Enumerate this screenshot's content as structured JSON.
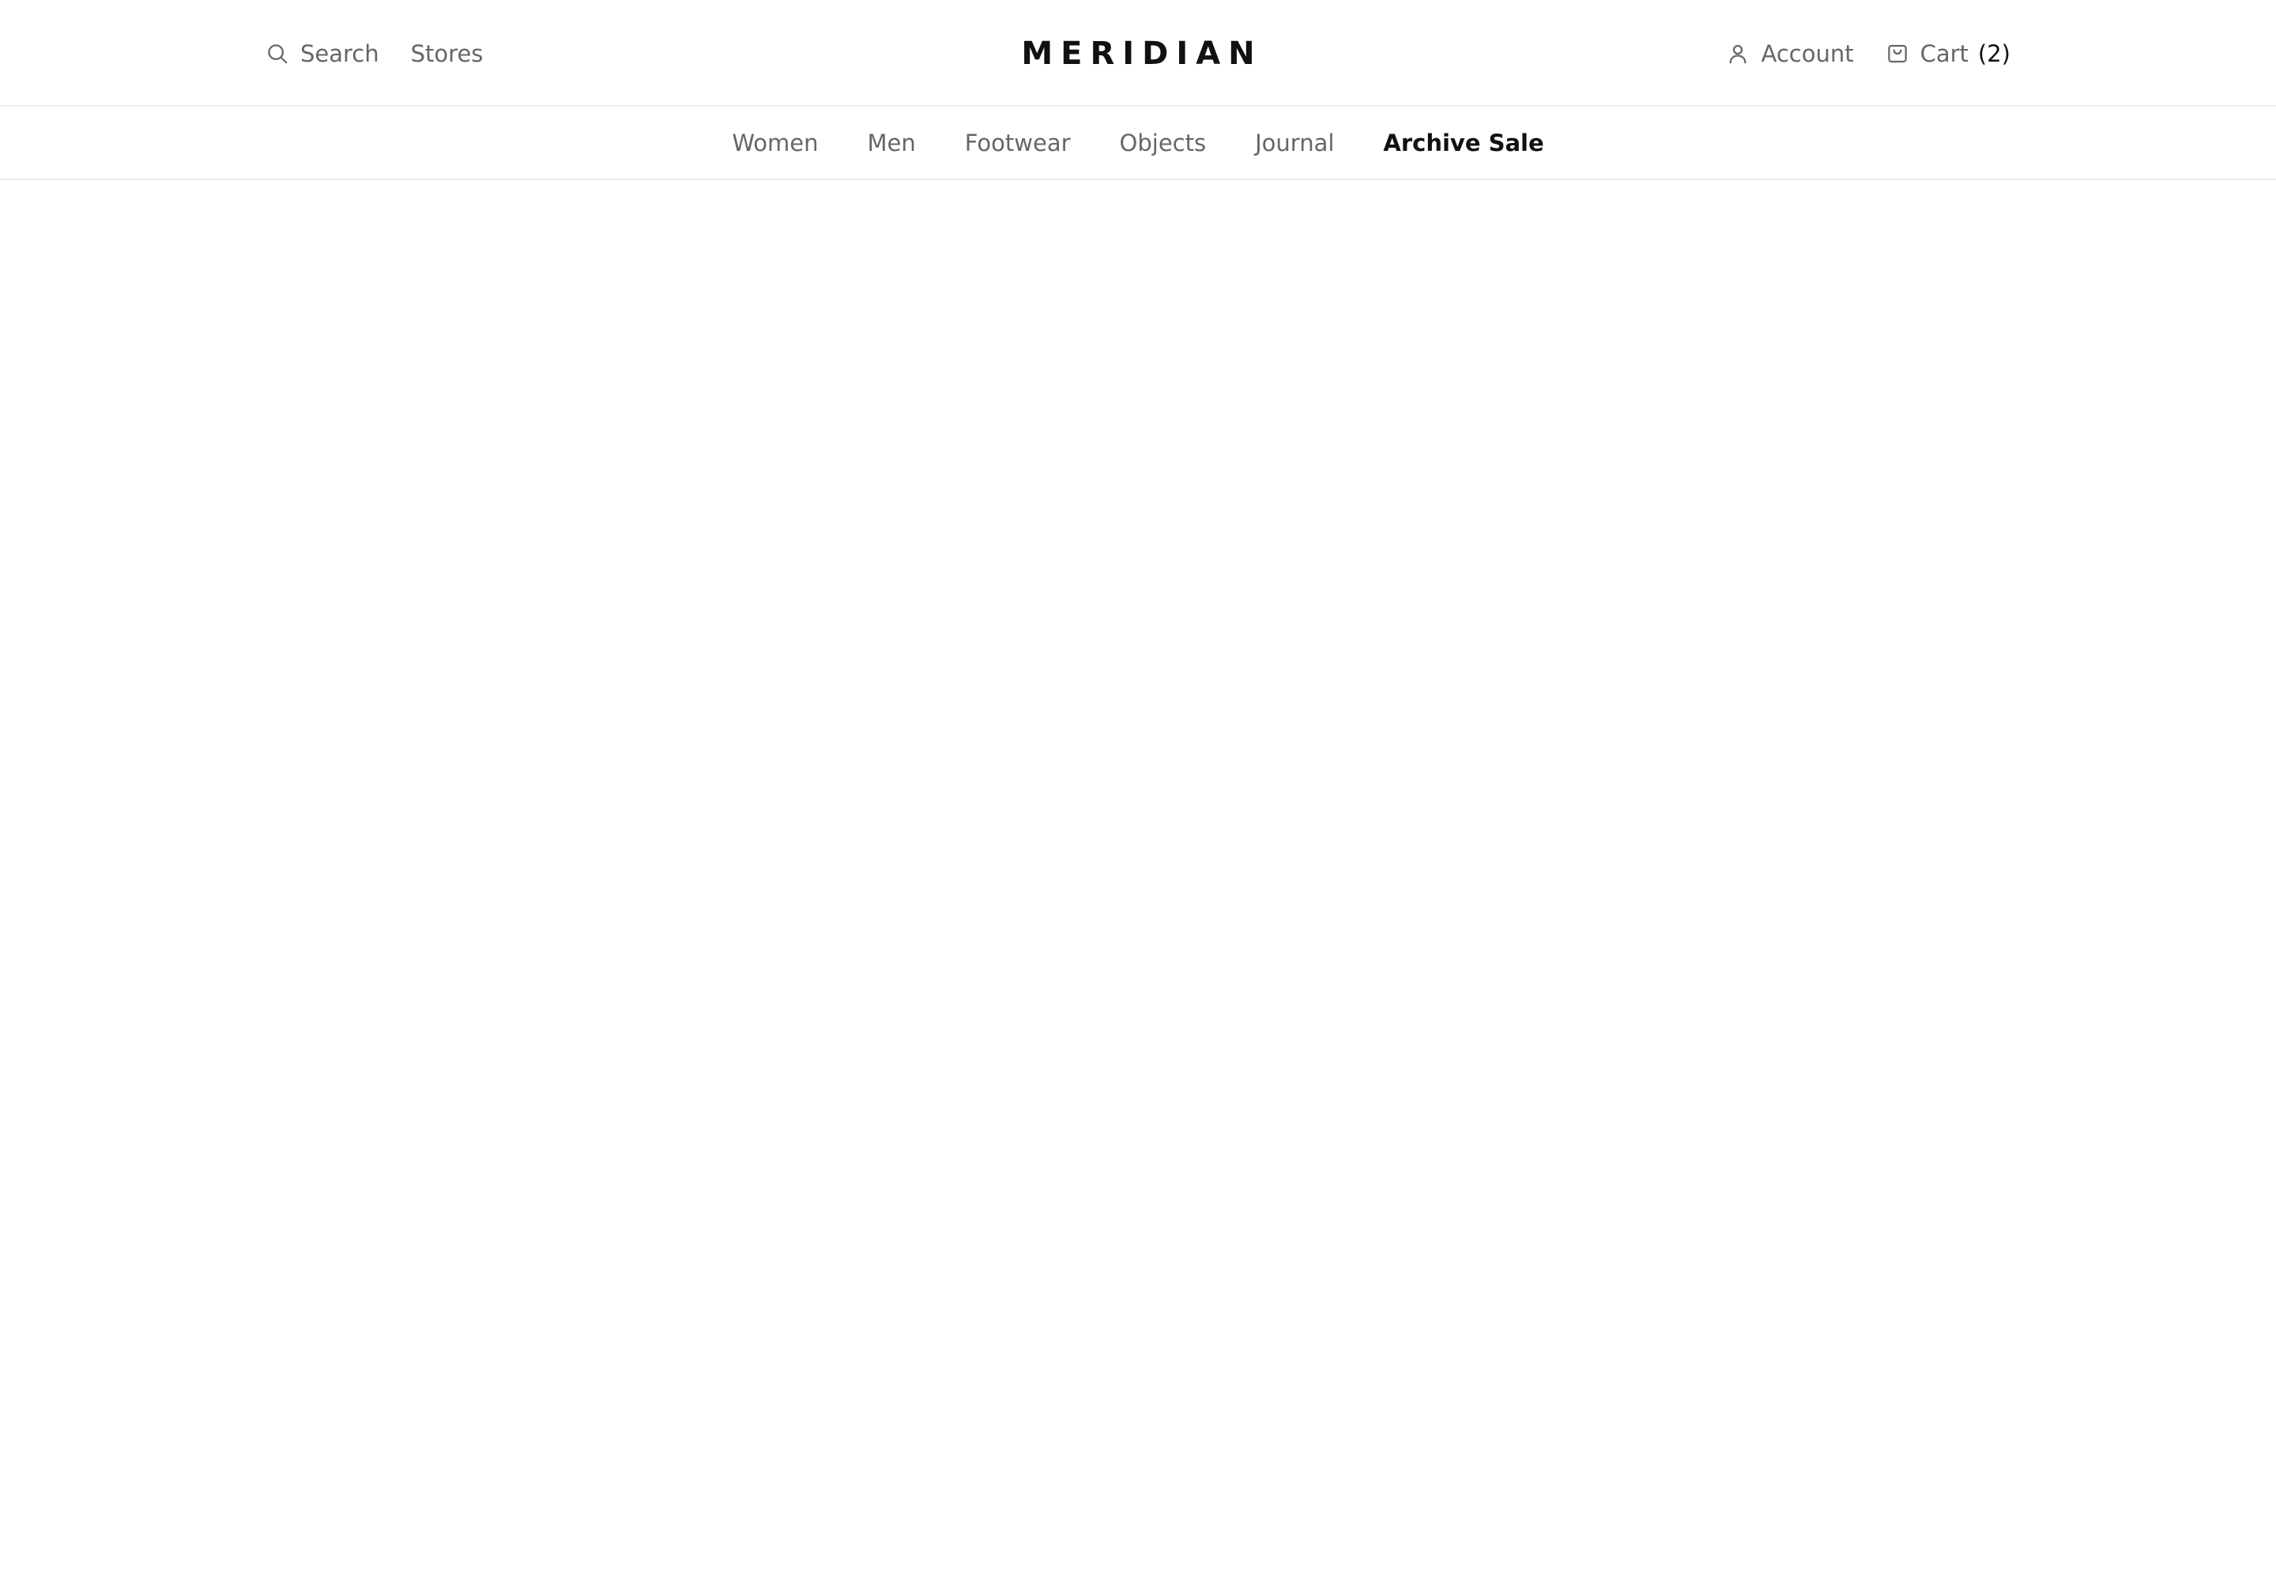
{
  "brand": {
    "name": "MERIDIAN"
  },
  "header": {
    "search_label": "Search",
    "stores_label": "Stores",
    "account_label": "Account",
    "cart_label": "Cart",
    "cart_count": "(2)"
  },
  "nav": {
    "items": [
      {
        "label": "Women",
        "active": false
      },
      {
        "label": "Men",
        "active": false
      },
      {
        "label": "Footwear",
        "active": false
      },
      {
        "label": "Objects",
        "active": false
      },
      {
        "label": "Journal",
        "active": false
      },
      {
        "label": "Archive Sale",
        "active": true
      }
    ]
  },
  "icons": {
    "search": "search-icon",
    "account": "user-icon",
    "cart": "shopping-bag-icon"
  },
  "colors": {
    "background": "#ffffff",
    "text_muted": "#666666",
    "text_strong": "#111111",
    "divider": "#ececec"
  }
}
